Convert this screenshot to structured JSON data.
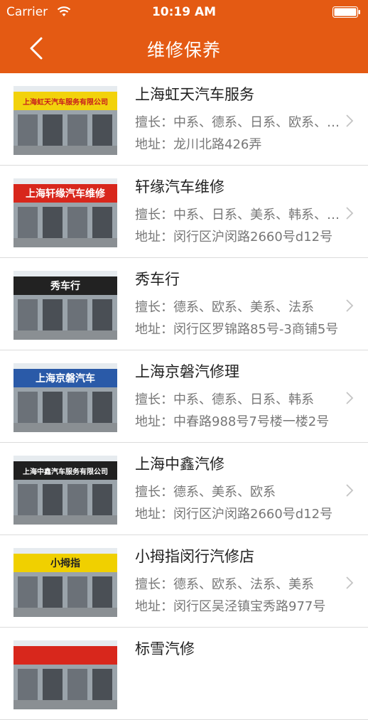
{
  "status": {
    "carrier": "Carrier",
    "time": "10:19 AM"
  },
  "nav": {
    "title": "维修保养"
  },
  "shops": [
    {
      "name": "上海虹天汽车服务",
      "specialty": "擅长：中系、德系、日系、欧系、美系",
      "address": "地址：龙川北路426弄",
      "sign_text": "上海虹天汽车服务有限公司",
      "sign_color": "#f2d20c",
      "sign_text_color": "#c81e1e"
    },
    {
      "name": "轩缘汽车维修",
      "specialty": "擅长：中系、日系、美系、韩系、德系",
      "address": "地址：闵行区沪闵路2660号d12号",
      "sign_text": "上海轩缘汽车维修",
      "sign_color": "#d8271c",
      "sign_text_color": "#ffffff"
    },
    {
      "name": "秀车行",
      "specialty": "擅长：德系、欧系、美系、法系",
      "address": "地址：闵行区罗锦路85号-3商铺5号",
      "sign_text": "秀车行",
      "sign_color": "#222222",
      "sign_text_color": "#ffffff"
    },
    {
      "name": "上海京磐汽修理",
      "specialty": "擅长：中系、德系、日系、韩系",
      "address": "地址：中春路988号7号楼一楼2号",
      "sign_text": "上海京磐汽车",
      "sign_color": "#2a5aa8",
      "sign_text_color": "#ffffff"
    },
    {
      "name": "上海中鑫汽修",
      "specialty": "擅长：德系、美系、欧系",
      "address": "地址：闵行区沪闵路2660号d12号",
      "sign_text": "上海中鑫汽车服务有限公司",
      "sign_color": "#202020",
      "sign_text_color": "#ffffff"
    },
    {
      "name": "小拇指闵行汽修店",
      "specialty": "擅长：德系、欧系、法系、美系",
      "address": "地址：闵行区吴泾镇宝秀路977号",
      "sign_text": "小拇指",
      "sign_color": "#f0d000",
      "sign_text_color": "#222222"
    },
    {
      "name": "标雪汽修",
      "specialty": "",
      "address": "",
      "sign_text": "",
      "sign_color": "#d8271c",
      "sign_text_color": "#ffffff"
    }
  ],
  "colors": {
    "brand": "#e45a13",
    "divider": "#dcdcdc",
    "muted_text": "#777777"
  }
}
